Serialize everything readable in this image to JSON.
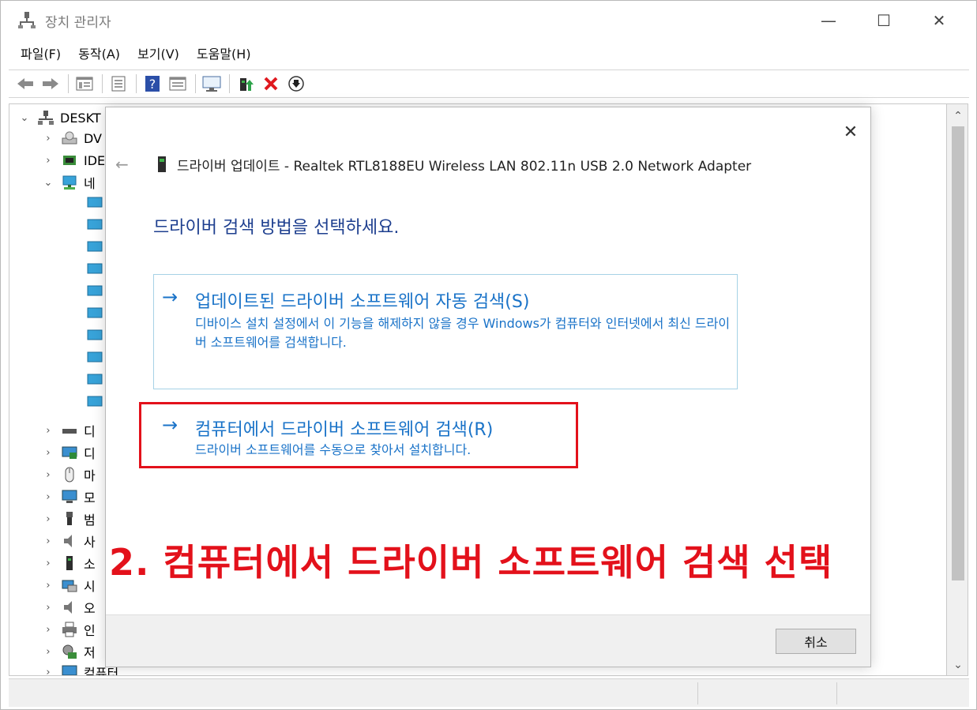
{
  "window": {
    "title": "장치 관리자",
    "minimize_glyph": "—",
    "maximize_glyph": "☐",
    "close_glyph": "✕"
  },
  "menu": [
    "파일(F)",
    "동작(A)",
    "보기(V)",
    "도움말(H)"
  ],
  "toolbar": {
    "icons": [
      "back-icon",
      "forward-icon",
      "properties-pane-icon",
      "print-icon",
      "help-icon",
      "view-icon",
      "monitor-icon",
      "update-driver-icon",
      "remove-device-icon",
      "download-icon"
    ]
  },
  "tree": {
    "root_label": "DESKT",
    "rows": [
      "DV",
      "IDE",
      "네",
      "디",
      "디",
      "마",
      "모",
      "범",
      "사",
      "소",
      "시",
      "오",
      "인",
      "저",
      "컴퓨터"
    ]
  },
  "dialog": {
    "close_glyph": "✕",
    "back_glyph": "←",
    "title": "드라이버 업데이트 - Realtek RTL8188EU Wireless LAN 802.11n USB 2.0 Network Adapter",
    "question": "드라이버 검색 방법을 선택하세요.",
    "options": [
      {
        "arrow": "→",
        "title": "업데이트된 드라이버 소프트웨어 자동 검색(S)",
        "desc": "디바이스 설치 설정에서 이 기능을 해제하지 않을 경우 Windows가 컴퓨터와 인터넷에서 최신 드라이버 소프트웨어를 검색합니다."
      },
      {
        "arrow": "→",
        "title": "컴퓨터에서 드라이버 소프트웨어 검색(R)",
        "desc": "드라이버 소프트웨어를 수동으로 찾아서 설치합니다."
      }
    ],
    "cancel_label": "취소"
  },
  "annotation": "2. 컴퓨터에서 드라이버 소프트웨어 검색 선택",
  "colors": {
    "link_blue": "#1a73c8",
    "heading_blue": "#1e3f8f",
    "highlight_red": "#e3111b"
  }
}
